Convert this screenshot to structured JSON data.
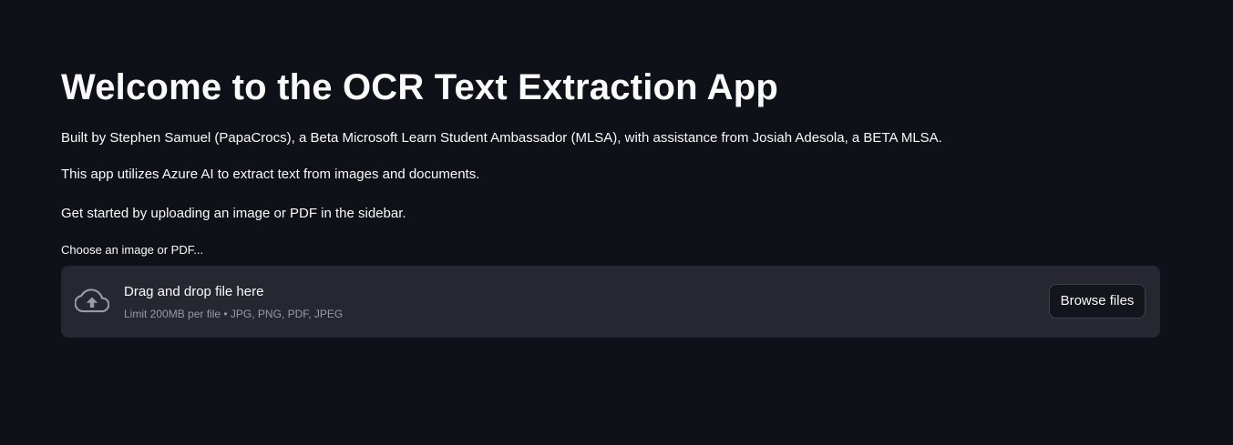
{
  "main": {
    "title": "Welcome to the OCR Text Extraction App",
    "paragraphs": [
      "Built by Stephen Samuel (PapaCrocs), a Beta Microsoft Learn Student Ambassador (MLSA), with assistance from Josiah Adesola, a BETA MLSA.",
      "This app utilizes Azure AI to extract text from images and documents.",
      "Get started by uploading an image or PDF in the sidebar."
    ]
  },
  "uploader": {
    "label": "Choose an image or PDF...",
    "drop_text": "Drag and drop file here",
    "limit_text": "Limit 200MB per file • JPG, PNG, PDF, JPEG",
    "button_label": "Browse files",
    "icon": "cloud-upload-icon"
  },
  "colors": {
    "background": "#0e1117",
    "dropzone": "#262730",
    "text": "#fafafa",
    "muted_text": "#9a9ba1"
  }
}
